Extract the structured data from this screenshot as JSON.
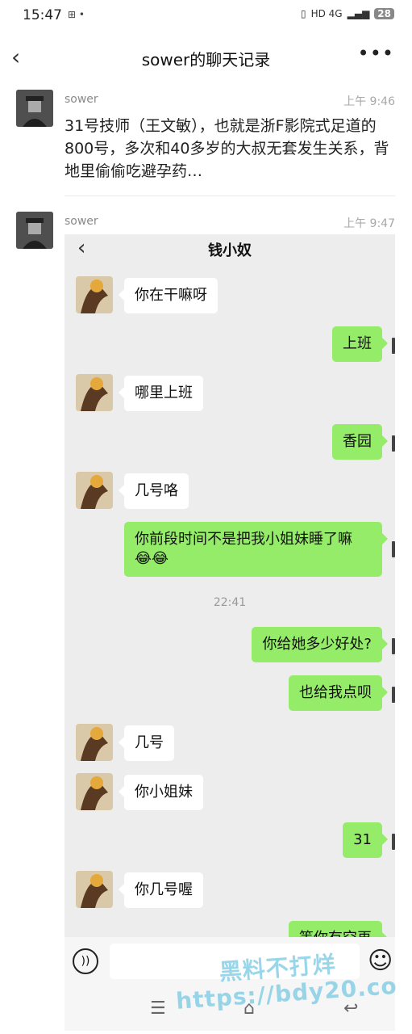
{
  "status_bar": {
    "time": "15:47",
    "indicators": "⊞ •",
    "network": "HD 4G",
    "battery": "28"
  },
  "nav": {
    "title": "sower的聊天记录",
    "back_icon": "chevron-left-icon",
    "more_icon": "more-dots-icon"
  },
  "records": [
    {
      "name": "sower",
      "time": "上午 9:46",
      "text": "31号技师（王文敏），也就是浙F影院式足道的800号，多次和40多岁的大叔无套发生关系，背地里偷偷吃避孕药…"
    },
    {
      "name": "sower",
      "time": "上午 9:47"
    }
  ],
  "screenshot": {
    "title": "钱小奴",
    "timestamp": "22:41",
    "messages": [
      {
        "side": "in",
        "text": "你在干嘛呀"
      },
      {
        "side": "out",
        "text": "上班"
      },
      {
        "side": "in",
        "text": "哪里上班"
      },
      {
        "side": "out",
        "text": "香园"
      },
      {
        "side": "in",
        "text": "几号咯"
      },
      {
        "side": "out",
        "text": "你前段时间不是把我小姐妹睡了嘛",
        "emoji": "😂😂"
      },
      {
        "side": "out",
        "text": "你给她多少好处?"
      },
      {
        "side": "out",
        "text": "也给我点呗"
      },
      {
        "side": "in",
        "text": "几号"
      },
      {
        "side": "in",
        "text": "你小姐妹"
      },
      {
        "side": "out",
        "text": "31"
      },
      {
        "side": "in",
        "text": "你几号喔"
      },
      {
        "side": "out",
        "text": "等你有空再"
      }
    ],
    "input_bar": {
      "voice_icon": "voice-icon",
      "emoji_icon": "emoji-icon"
    },
    "nav_buttons": [
      "☰",
      "⌂",
      "↩"
    ]
  },
  "watermark": {
    "line1": "黑料不打烊",
    "line2": "https://bdy20.co"
  }
}
